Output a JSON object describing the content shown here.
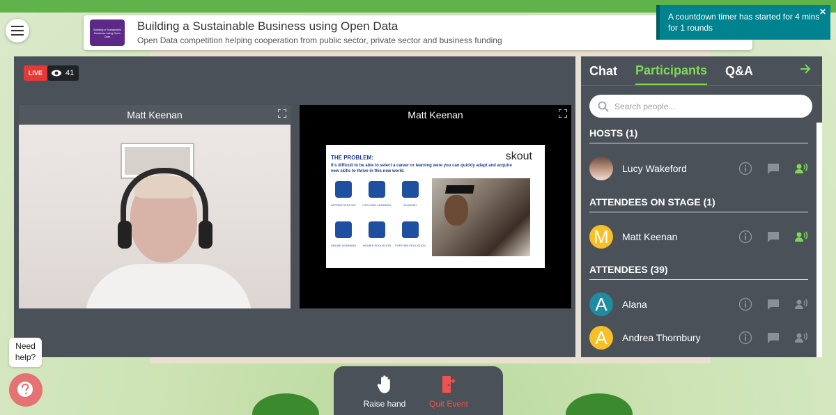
{
  "app": {
    "brand_color": "#7ed957",
    "live_color": "#e53935"
  },
  "header": {
    "logo_text": "Building a Sustainable Business using Open Data",
    "title": "Building a Sustainable Business using Open Data",
    "subtitle": "Open Data competition helping cooperation from public sector, private sector and business funding"
  },
  "toast": {
    "message": "A countdown timer has started for 4 mins for 1 rounds",
    "close_icon": "close-icon"
  },
  "stage": {
    "live_label": "LIVE",
    "viewers_count": "41",
    "tiles": [
      {
        "name": "Matt Keenan",
        "kind": "camera"
      },
      {
        "name": "Matt Keenan",
        "kind": "screen-share"
      }
    ],
    "slide": {
      "title": "THE PROBLEM:",
      "text": "It's difficult to be able to select a career or learning were you can quickly adapt and acquire new skills to thrive in this new world.",
      "logo": "skout",
      "items": [
        "APPRENTICES HIP",
        "LIFELONG LEARNING",
        "ACADEMY",
        "ONLINE LEARNING",
        "HIGHER EDUCATION",
        "FURTHER EDUCATION"
      ]
    }
  },
  "panel": {
    "tabs": [
      {
        "label": "Chat",
        "active": false
      },
      {
        "label": "Participants",
        "active": true
      },
      {
        "label": "Q&A",
        "active": false
      }
    ],
    "search_placeholder": "Search people...",
    "hosts_heading": "HOSTS (1)",
    "hosts": [
      {
        "name": "Lucy Wakeford",
        "avatar": "photo",
        "mic_active": true
      }
    ],
    "stage_heading": "ATTENDEES ON STAGE (1)",
    "on_stage": [
      {
        "name": "Matt Keenan",
        "avatar_letter": "M",
        "avatar_color": "#f6c026",
        "mic_active": true
      }
    ],
    "attendees_heading": "ATTENDEES (39)",
    "attendees": [
      {
        "name": "Alana",
        "avatar_letter": "A",
        "avatar_color": "#1e8c9e",
        "mic_active": false
      },
      {
        "name": "Andrea Thornbury",
        "avatar_letter": "A",
        "avatar_color": "#f6c026",
        "mic_active": false
      }
    ]
  },
  "help": {
    "label_line1": "Need",
    "label_line2": "help?"
  },
  "bottom_bar": {
    "raise_hand_label": "Raise hand",
    "quit_label": "Quit Event"
  }
}
